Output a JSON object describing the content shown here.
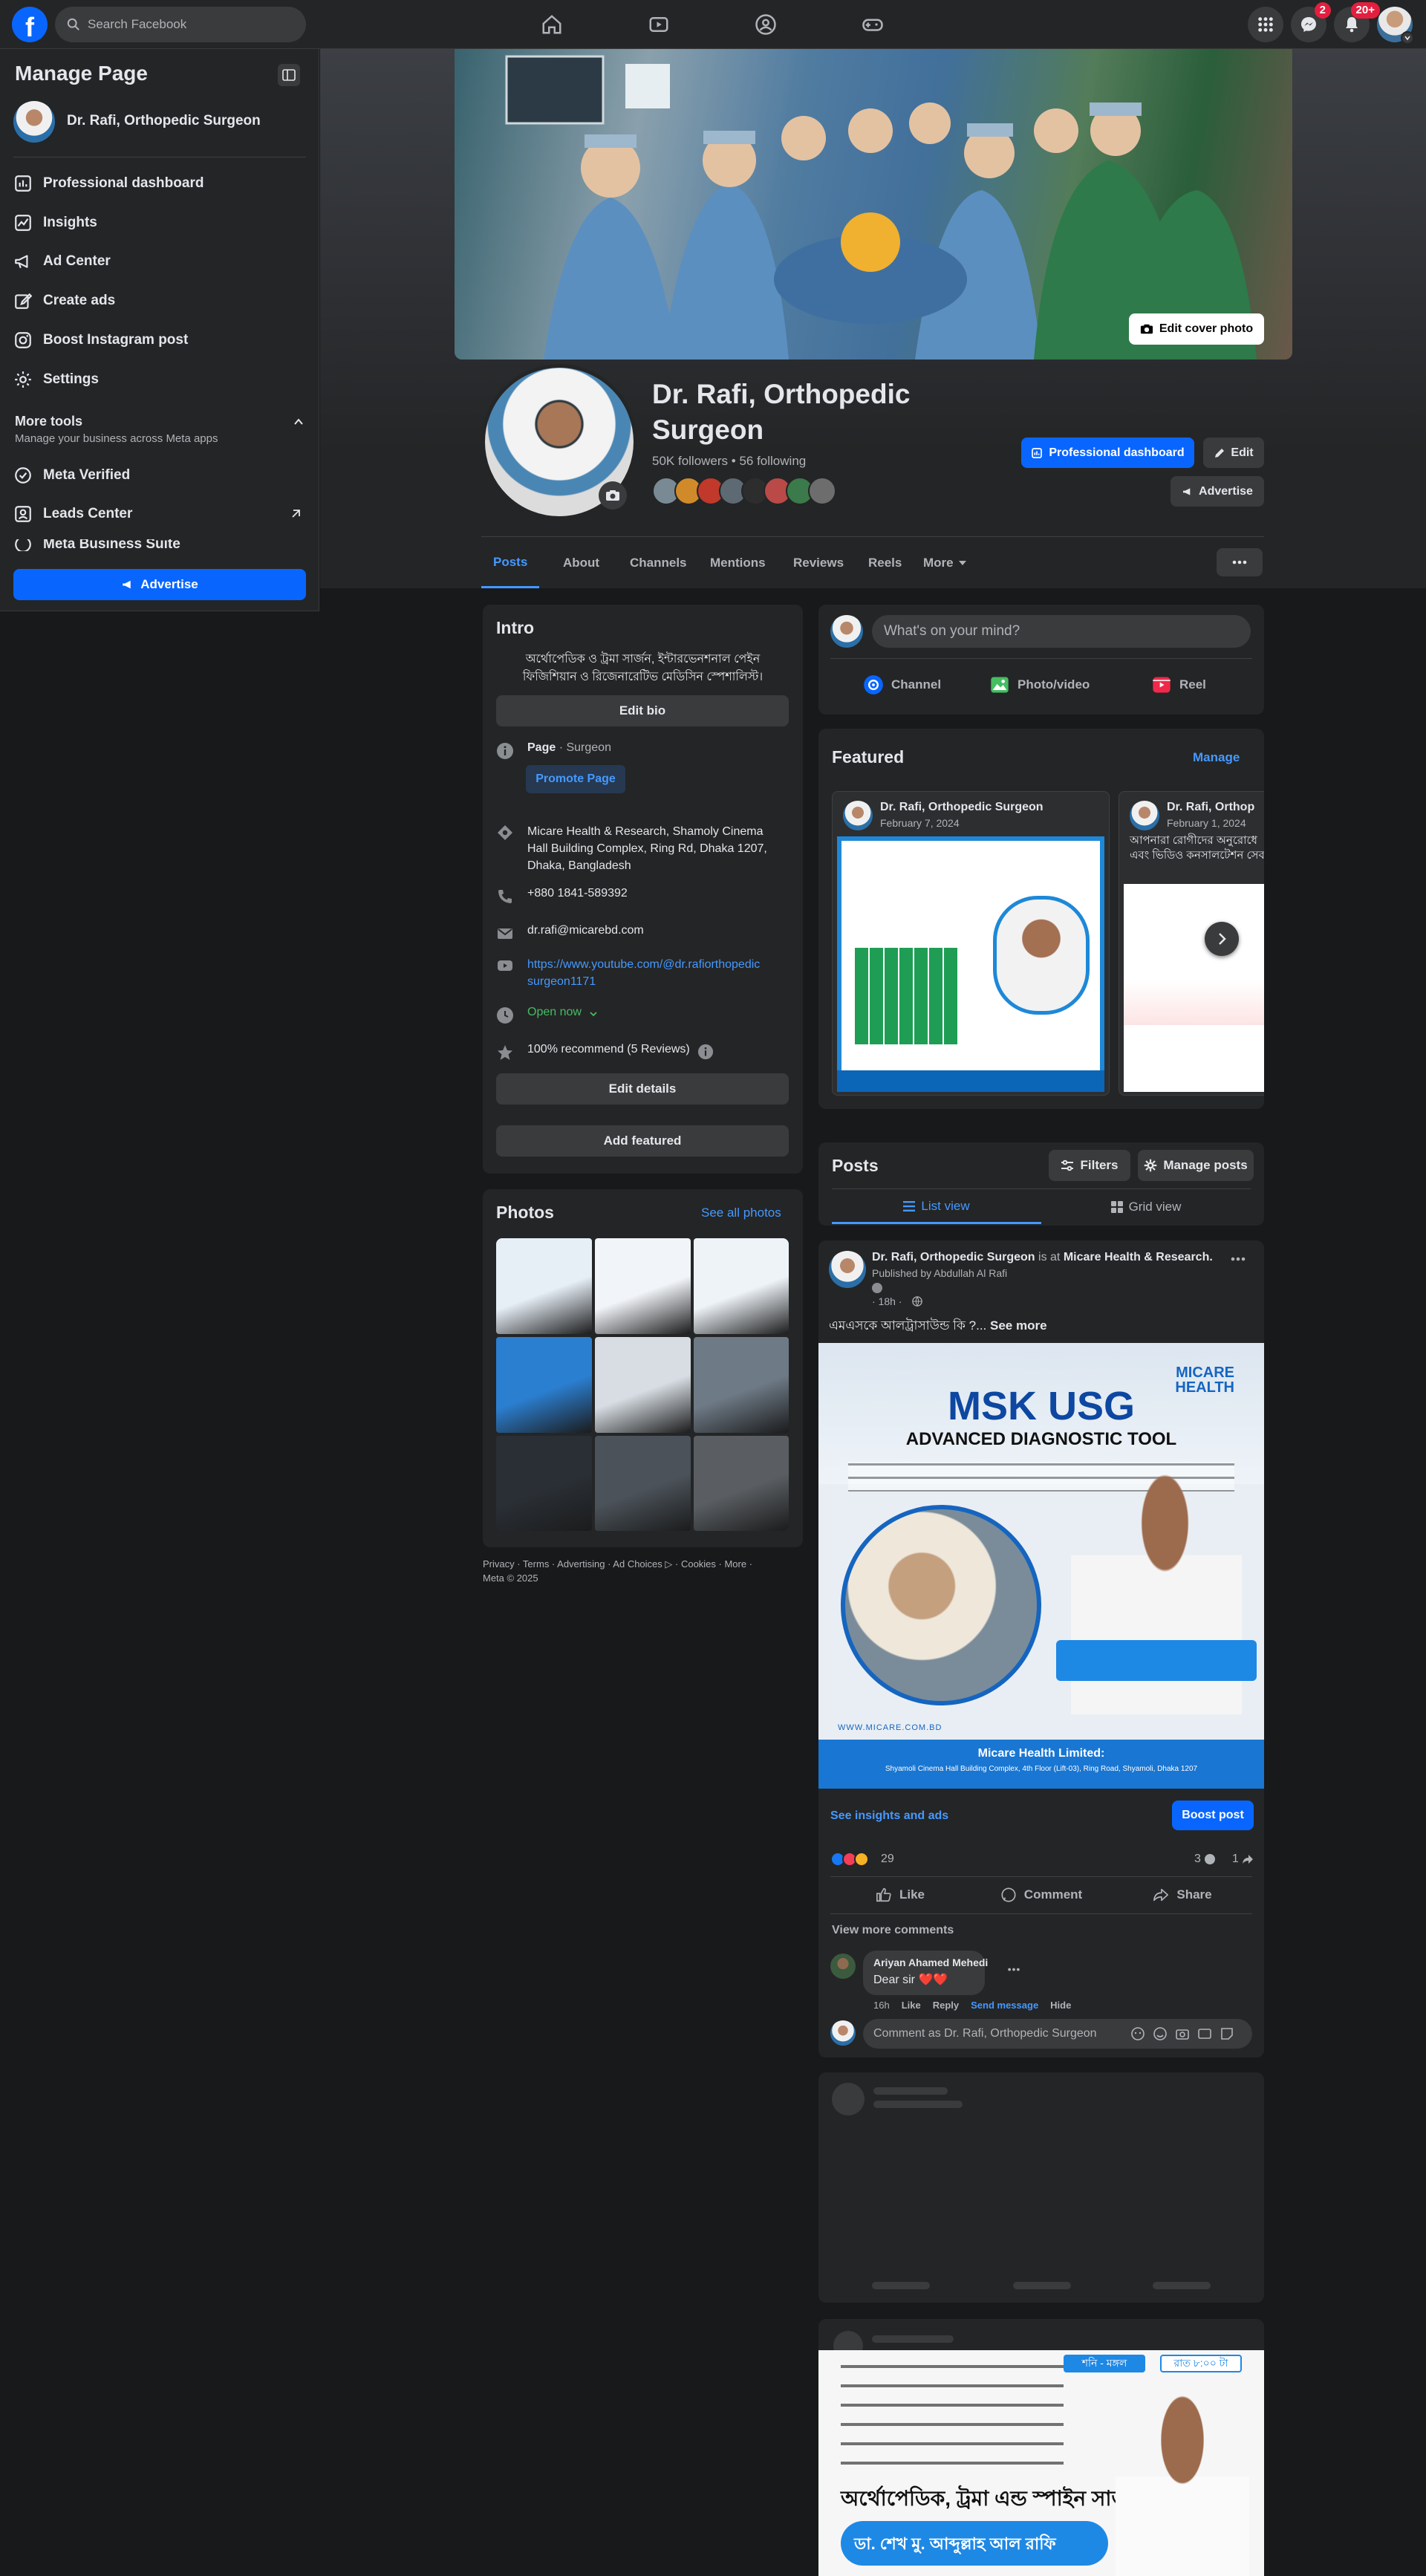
{
  "topnav": {
    "search_placeholder": "Search Facebook",
    "messenger_badge": "2",
    "notifications_badge": "20+"
  },
  "sidebar": {
    "title": "Manage Page",
    "page_name": "Dr. Rafi, Orthopedic Surgeon",
    "items": [
      {
        "label": "Professional dashboard",
        "icon": "dashboard-icon"
      },
      {
        "label": "Insights",
        "icon": "insights-icon"
      },
      {
        "label": "Ad Center",
        "icon": "megaphone-icon"
      },
      {
        "label": "Create ads",
        "icon": "pencil-icon"
      },
      {
        "label": "Boost Instagram post",
        "icon": "instagram-icon"
      },
      {
        "label": "Settings",
        "icon": "gear-icon"
      }
    ],
    "more_tools_title": "More tools",
    "more_tools_subtitle": "Manage your business across Meta apps",
    "more_items": [
      {
        "label": "Meta Verified",
        "icon": "verified-icon"
      },
      {
        "label": "Leads Center",
        "icon": "leads-icon"
      },
      {
        "label": "Meta Business Suite",
        "icon": "business-suite-icon"
      }
    ],
    "advertise_label": "Advertise"
  },
  "cover": {
    "edit_cover_label": "Edit cover photo"
  },
  "profile": {
    "name_line1": "Dr. Rafi, Orthopedic",
    "name_line2": "Surgeon",
    "stats": "50K followers • 56 following",
    "professional_dashboard_label": "Professional dashboard",
    "edit_label": "Edit",
    "advertise_label": "Advertise"
  },
  "tabs": [
    {
      "label": "Posts",
      "active": true
    },
    {
      "label": "About"
    },
    {
      "label": "Channels"
    },
    {
      "label": "Mentions"
    },
    {
      "label": "Reviews"
    },
    {
      "label": "Reels"
    },
    {
      "label": "More"
    }
  ],
  "intro": {
    "title": "Intro",
    "bio_line1": "অর্থোপেডিক ও ট্রমা সার্জন, ইন্টারভেনশনাল পেইন",
    "bio_line2": "ফিজিশিয়ান ও রিজেনারেটিভ মেডিসিন স্পেশালিস্ট।",
    "edit_bio": "Edit bio",
    "page_type_bold": "Page",
    "page_type_rest": " · Surgeon",
    "promote_page": "Promote Page",
    "address_line1": "Micare Health & Research, Shamoly Cinema",
    "address_line2": "Hall Building Complex, Ring Rd, Dhaka 1207,",
    "address_line3": "Dhaka, Bangladesh",
    "phone": "+880 1841-589392",
    "email": "dr.rafi@micarebd.com",
    "youtube_line1": "https://www.youtube.com/@dr.rafiorthopedic",
    "youtube_line2": "surgeon1171",
    "hours": "Open now",
    "recommend": "100% recommend (5 Reviews)",
    "edit_details": "Edit details",
    "add_featured": "Add featured"
  },
  "photos": {
    "title": "Photos",
    "see_all": "See all photos",
    "colors": [
      "#e6eef6",
      "#f1f4f8",
      "#eef3f8",
      "#2b7fd1",
      "#d7dde3",
      "#6e7a86",
      "#2a2f35",
      "#4b5259",
      "#5a5e62"
    ]
  },
  "footer": {
    "line1": "Privacy · Terms · Advertising · Ad Choices ▷ · Cookies · More ·",
    "line2": "Meta © 2025"
  },
  "composer": {
    "placeholder": "What's on your mind?",
    "channel": "Channel",
    "photo_video": "Photo/video",
    "reel": "Reel"
  },
  "featured": {
    "title": "Featured",
    "manage": "Manage",
    "card1_name": "Dr. Rafi, Orthopedic Surgeon",
    "card1_date": "February 7, 2024",
    "card2_name": "Dr. Rafi, Orthop",
    "card2_date": "February 1, 2024",
    "card2_text": "আপনারা রোগীদের অনুরোধে এবং ভিডিও কনসালটেশন সেবা"
  },
  "posts_header": {
    "title": "Posts",
    "filters": "Filters",
    "manage_posts": "Manage posts",
    "list_view": "List view",
    "grid_view": "Grid view"
  },
  "post": {
    "author": "Dr. Rafi, Orthopedic Surgeon",
    "is_at": " is at ",
    "location": "Micare Health & Research.",
    "published_by": "Published by Abdullah Al Rafi",
    "time": "· 18h ·",
    "text": "এমএসকে আলট্রাসাউন্ড কি ?...",
    "see_more": "See more",
    "image_brand": "MICARE HEALTH",
    "image_title": "MSK USG",
    "image_subtitle": "ADVANCED DIAGNOSTIC TOOL",
    "image_footer1": "Micare Health Limited:",
    "image_footer2": "Shyamoli Cinema Hall Building Complex, 4th Floor (Lift-03), Ring Road, Shyamoli, Dhaka 1207",
    "image_url": "WWW.MICARE.COM.BD",
    "see_insights": "See insights and ads",
    "boost": "Boost post",
    "reactions": "29",
    "comments_count": "3",
    "shares_count": "1",
    "like": "Like",
    "comment": "Comment",
    "share": "Share",
    "view_more_comments": "View more comments",
    "commenter": "Ariyan Ahamed Mehedi",
    "comment_text": "Dear sir ❤️❤️",
    "comment_time": "16h",
    "comment_like": "Like",
    "comment_reply": "Reply",
    "comment_send": "Send message",
    "comment_hide": "Hide",
    "comment_placeholder": "Comment as Dr. Rafi, Orthopedic Surgeon"
  },
  "bottom_post": {
    "tag1": "শনি - মঙ্গল",
    "tag2": "রাত ৮:০০ টা",
    "heading": "অর্থোপেডিক, ট্রমা এন্ড স্পাইন সার্জন",
    "doctor_name": "ডা. শেখ মু. আব্দুল্লাহ আল রাফি"
  }
}
